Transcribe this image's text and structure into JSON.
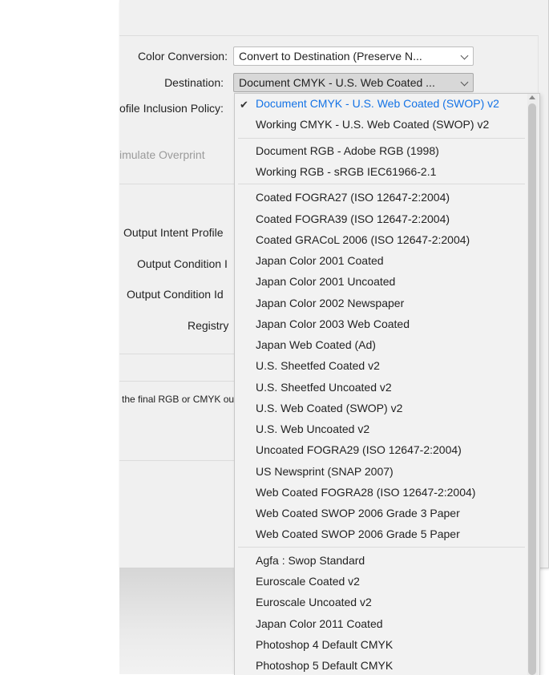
{
  "dialog": {
    "color_conversion": {
      "label": "Color Conversion:",
      "value": "Convert to Destination (Preserve N..."
    },
    "destination": {
      "label": "Destination:",
      "value": "Document CMYK - U.S. Web Coated ..."
    },
    "profile_policy": {
      "label": "ofile Inclusion Policy:"
    },
    "simulate_overprint": {
      "label": "imulate Overprint"
    },
    "output_intent_profile": {
      "label": "Output Intent Profile"
    },
    "output_condition_name": {
      "label": "Output Condition I"
    },
    "output_condition_id": {
      "label": "Output Condition Id"
    },
    "registry": {
      "label": "Registry"
    },
    "description": "the final RGB or CMYK ou"
  },
  "menu": {
    "selected_index": 0,
    "items": [
      "Document CMYK - U.S. Web Coated (SWOP) v2",
      "Working CMYK - U.S. Web Coated (SWOP) v2",
      "Document RGB - Adobe RGB (1998)",
      "Working RGB - sRGB IEC61966-2.1",
      "Coated FOGRA27 (ISO 12647-2:2004)",
      "Coated FOGRA39 (ISO 12647-2:2004)",
      "Coated GRACoL 2006 (ISO 12647-2:2004)",
      "Japan Color 2001 Coated",
      "Japan Color 2001 Uncoated",
      "Japan Color 2002 Newspaper",
      "Japan Color 2003 Web Coated",
      "Japan Web Coated (Ad)",
      "U.S. Sheetfed Coated v2",
      "U.S. Sheetfed Uncoated v2",
      "U.S. Web Coated (SWOP) v2",
      "U.S. Web Uncoated v2",
      "Uncoated FOGRA29 (ISO 12647-2:2004)",
      "US Newsprint (SNAP 2007)",
      "Web Coated FOGRA28 (ISO 12647-2:2004)",
      "Web Coated SWOP 2006 Grade 3 Paper",
      "Web Coated SWOP 2006 Grade 5 Paper",
      "Agfa : Swop Standard",
      "Euroscale Coated v2",
      "Euroscale Uncoated v2",
      "Japan Color 2011 Coated",
      "Photoshop 4 Default CMYK",
      "Photoshop 5 Default CMYK"
    ]
  },
  "colors": {
    "selected": "#1473e6"
  },
  "icons": {
    "check": "checkmark-icon",
    "dropdown": "chevron-down-icon"
  }
}
